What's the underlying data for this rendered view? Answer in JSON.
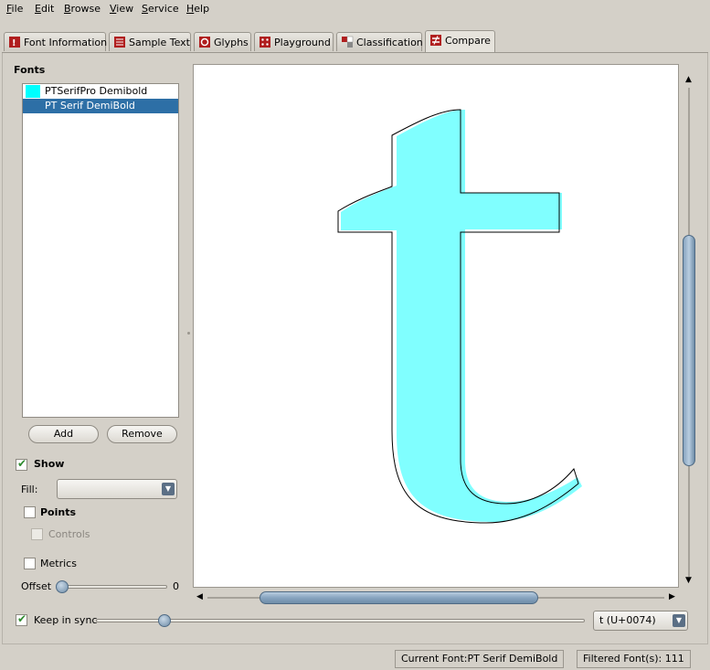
{
  "menu": [
    {
      "accel": "F",
      "rest": "ile"
    },
    {
      "accel": "E",
      "rest": "dit"
    },
    {
      "accel": "B",
      "rest": "rowse"
    },
    {
      "accel": "V",
      "rest": "iew"
    },
    {
      "accel": "S",
      "rest": "ervice"
    },
    {
      "accel": "H",
      "rest": "elp"
    }
  ],
  "tabs": [
    "Font Information",
    "Sample Text",
    "Glyphs",
    "Playground",
    "Classification",
    "Compare"
  ],
  "active_tab": "Compare",
  "fonts_panel": {
    "title": "Fonts",
    "items": [
      {
        "label": "PTSerifPro Demibold",
        "color": "#00ffff",
        "selected": false
      },
      {
        "label": "PT Serif DemiBold",
        "color": "#2d6fa6",
        "selected": true
      }
    ],
    "add_label": "Add",
    "remove_label": "Remove"
  },
  "options": {
    "show_label": "Show",
    "show_checked": true,
    "fill_label": "Fill:",
    "fill_value": "",
    "points_label": "Points",
    "points_checked": false,
    "controls_label": "Controls",
    "controls_checked": false,
    "metrics_label": "Metrics",
    "metrics_checked": false,
    "offset_label": "Offset",
    "offset_value": "0",
    "offset_level": 0
  },
  "glyph": {
    "char": "t",
    "fill_color": "#80ffff",
    "outline_color": "#000000"
  },
  "scrollbars": {
    "vertical_position_fraction": 0.5,
    "horizontal_position_fraction": 0.5
  },
  "bottom": {
    "keep_in_sync_label": "Keep in sync",
    "keep_in_sync_checked": true,
    "sync_level": 0.13,
    "glyph_select_value": "t  (U+0074)"
  },
  "status": {
    "current_font": "Current Font:PT Serif DemiBold",
    "filtered_fonts": "Filtered Font(s): 111"
  },
  "colors": {
    "accent": "#2d6fa6",
    "check_green": "#2e8b2e",
    "glyph_cyan": "#80ffff"
  }
}
